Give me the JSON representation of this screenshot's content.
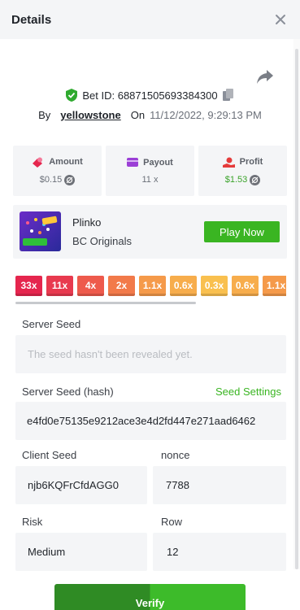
{
  "header": {
    "title": "Details"
  },
  "bet": {
    "id_label": "Bet ID: 68871505693384300",
    "by_label": "By",
    "user": "yellowstone",
    "on_label": "On",
    "date": "11/12/2022, 9:29:13 PM"
  },
  "stats": {
    "amount": {
      "label": "Amount",
      "value": "$0.15"
    },
    "payout": {
      "label": "Payout",
      "value": "11 x"
    },
    "profit": {
      "label": "Profit",
      "value": "$1.53"
    }
  },
  "game": {
    "name": "Plinko",
    "provider": "BC Originals",
    "play_label": "Play Now"
  },
  "multipliers": [
    {
      "label": "33x",
      "color": "#e5264e"
    },
    {
      "label": "11x",
      "color": "#e83a4f"
    },
    {
      "label": "4x",
      "color": "#ee5a4c"
    },
    {
      "label": "2x",
      "color": "#f27a4a"
    },
    {
      "label": "1.1x",
      "color": "#f59a4a"
    },
    {
      "label": "0.6x",
      "color": "#f7ad4c"
    },
    {
      "label": "0.3x",
      "color": "#f9c04f"
    },
    {
      "label": "0.6x",
      "color": "#f7ad4c"
    },
    {
      "label": "1.1x",
      "color": "#f59a4a"
    }
  ],
  "server_seed": {
    "label": "Server Seed",
    "placeholder": "The seed hasn't been revealed yet."
  },
  "server_seed_hash": {
    "label": "Server Seed (hash)",
    "settings_label": "Seed Settings",
    "value": "e4fd0e75135e9212ace3e4d2fd447e271aad6462"
  },
  "client_seed": {
    "label": "Client Seed",
    "value": "njb6KQFrCfdAGG0"
  },
  "nonce": {
    "label": "nonce",
    "value": "7788"
  },
  "risk": {
    "label": "Risk",
    "value": "Medium"
  },
  "row": {
    "label": "Row",
    "value": "12"
  },
  "verify_label": "Verify",
  "colors": {
    "accent": "#3ab522",
    "panel": "#f4f5f7"
  }
}
